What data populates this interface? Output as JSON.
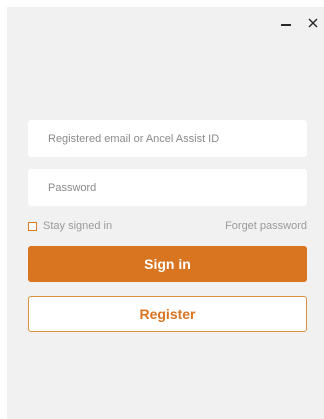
{
  "window": {
    "minimize_symbol": "",
    "close_symbol": "×",
    "background": "#f1f1f1"
  },
  "login": {
    "email_placeholder": "Registered email or Ancel Assist ID",
    "password_placeholder": "Password",
    "stay_signed_in_label": "Stay signed in",
    "stay_signed_in_checked": false,
    "forget_password_label": "Forget password",
    "sign_in_label": "Sign in",
    "register_label": "Register"
  },
  "colors": {
    "accent": "#d97421",
    "register_border": "#d9913f",
    "muted_text": "#9a9a9a"
  },
  "icons": {
    "minimize": "minimize-icon",
    "close": "close-icon",
    "checkbox": "checkbox-icon"
  }
}
